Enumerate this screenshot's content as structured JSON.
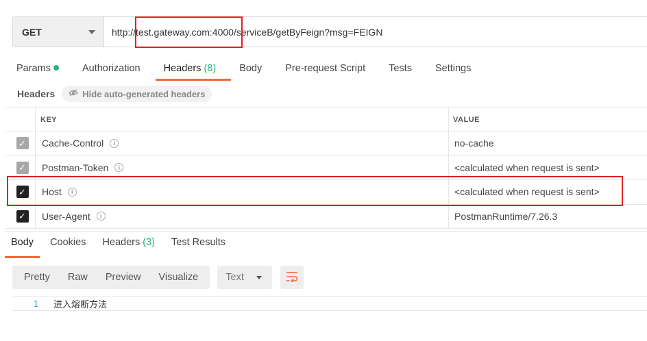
{
  "request": {
    "method": "GET",
    "url": "http://test.gateway.com:4000/serviceB/getByFeign?msg=FEIGN"
  },
  "request_tabs": [
    {
      "label": "Params",
      "has_dot": true
    },
    {
      "label": "Authorization"
    },
    {
      "label": "Headers",
      "count": "(8)",
      "active": true
    },
    {
      "label": "Body"
    },
    {
      "label": "Pre-request Script"
    },
    {
      "label": "Tests"
    },
    {
      "label": "Settings"
    }
  ],
  "headers_section": {
    "label": "Headers",
    "hide_button": "Hide auto-generated headers"
  },
  "table": {
    "col_key": "KEY",
    "col_value": "VALUE",
    "rows": [
      {
        "key": "Cache-Control",
        "value": "no-cache",
        "checked": true,
        "auto": true
      },
      {
        "key": "Postman-Token",
        "value": "<calculated when request is sent>",
        "checked": true,
        "auto": true
      },
      {
        "key": "Host",
        "value": "<calculated when request is sent>",
        "checked": true,
        "auto": false
      },
      {
        "key": "User-Agent",
        "value": "PostmanRuntime/7.26.3",
        "checked": true,
        "auto": false
      }
    ]
  },
  "response_tabs": [
    {
      "label": "Body",
      "active": true
    },
    {
      "label": "Cookies"
    },
    {
      "label": "Headers",
      "count": "(3)"
    },
    {
      "label": "Test Results"
    }
  ],
  "response_toolbar": {
    "views": [
      "Pretty",
      "Raw",
      "Preview",
      "Visualize"
    ],
    "language": "Text"
  },
  "response_body": {
    "line_number": "1",
    "text": "进入熔断方法"
  },
  "colors": {
    "accent": "#f26b3a",
    "success": "#26b47f",
    "highlight_box": "#e02020"
  }
}
